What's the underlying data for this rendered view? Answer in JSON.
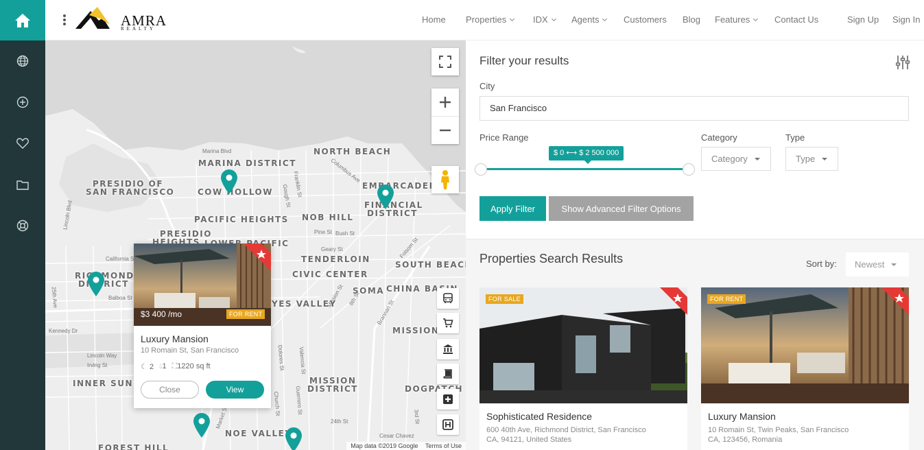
{
  "brand": {
    "name": "AMRA",
    "sub": "REALTY"
  },
  "rail": {
    "items": [
      "home-icon",
      "globe-icon",
      "plus-circle-icon",
      "heart-icon",
      "folder-icon",
      "support-icon"
    ]
  },
  "nav": {
    "home": "Home",
    "properties": "Properties",
    "idx": "IDX",
    "agents": "Agents",
    "customers": "Customers",
    "blog": "Blog",
    "features": "Features",
    "contact": "Contact Us",
    "signup": "Sign Up",
    "signin": "Sign In"
  },
  "map": {
    "districts": {
      "north_beach": "NORTH BEACH",
      "marina": "MARINA DISTRICT",
      "presidio": "PRESIDIO OF",
      "presidio2": "SAN FRANCISCO",
      "cow_hollow": "COW HOLLOW",
      "embarcadero": "EMBARCADERO",
      "financial": "FINANCIAL",
      "financial2": "DISTRICT",
      "pacific_heights": "PACIFIC HEIGHTS",
      "nob_hill": "NOB HILL",
      "presidio_heights": "PRESIDIO",
      "presidio_heights2": "HEIGHTS",
      "lower_pacific": "LOWER PACIFIC",
      "tenderloin": "TENDERLOIN",
      "south_beach": "SOUTH BEACH",
      "richmond": "RICHMOND",
      "richmond2": "DISTRICT",
      "civic_center": "CIVIC CENTER",
      "soma": "SOMA",
      "china_basin": "CHINA BASIN",
      "haves_valley": "YES VALLEY",
      "mission": "MISSION",
      "inner_sunset": "INNER SUNS",
      "mission_district": "MISSION",
      "mission_district2": "DISTRICT",
      "dogpatch": "DOGPATCH",
      "noe_valley": "NOE VALLEY",
      "forest_hill": "FOREST HILL"
    },
    "streets": {
      "marina_blvd": "Marina Blvd",
      "columbus": "Columbus Ave",
      "franklin": "Franklin St",
      "gough": "Gough St",
      "pine": "Pine St",
      "bush": "Bush St",
      "geary": "Geary St",
      "folsom": "Folsom St",
      "california": "California St",
      "lincoln": "Lincoln Blvd",
      "balboa": "Balboa St",
      "kennedy": "Kennedy Dr",
      "lincoln_way": "Lincoln Way",
      "irving": "Irving St",
      "twentyfifth": "25th Ave",
      "mission_st": "Mission St",
      "eighth": "8th St",
      "sixteenth": "16th St",
      "brannan": "Brannan St",
      "dolores": "Dolores St",
      "valencia": "Valencia St",
      "guerrero": "Guerrero St",
      "church": "Church St",
      "market": "Market St",
      "twentyfourth": "24th St",
      "cesar_chavez": "Cesar Chavez",
      "third": "3rd St"
    },
    "attribution": "Map data ©2019 Google",
    "terms": "Terms of Use",
    "popup": {
      "price": "$3 400 /mo",
      "tag": "FOR RENT",
      "title": "Luxury Mansion",
      "address": "10 Romain St, San Francisco",
      "beds": "2",
      "baths": "1",
      "area": "1220 sq ft",
      "close": "Close",
      "view": "View"
    }
  },
  "filter": {
    "title": "Filter your results",
    "city_label": "City",
    "city_value": "San Francisco",
    "price_label": "Price Range",
    "price_value": "$ 0 ⟷ $ 2 500 000",
    "category_label": "Category",
    "category_value": "Category",
    "type_label": "Type",
    "type_value": "Type",
    "apply": "Apply Filter",
    "advanced": "Show Advanced Filter Options"
  },
  "results": {
    "title": "Properties Search Results",
    "sort_label": "Sort by:",
    "sort_value": "Newest",
    "cards": [
      {
        "tag": "FOR SALE",
        "title": "Sophisticated Residence",
        "addr1": "600 40th Ave, Richmond District, San Francisco",
        "addr2": "CA, 94121, United States"
      },
      {
        "tag": "FOR RENT",
        "title": "Luxury Mansion",
        "addr1": "10 Romain St, Twin Peaks, San Francisco",
        "addr2": "CA, 123456, Romania"
      }
    ]
  },
  "colors": {
    "accent": "#14a09a",
    "rail": "#21373a",
    "tag": "#e8a720",
    "ribbon": "#e53935"
  }
}
